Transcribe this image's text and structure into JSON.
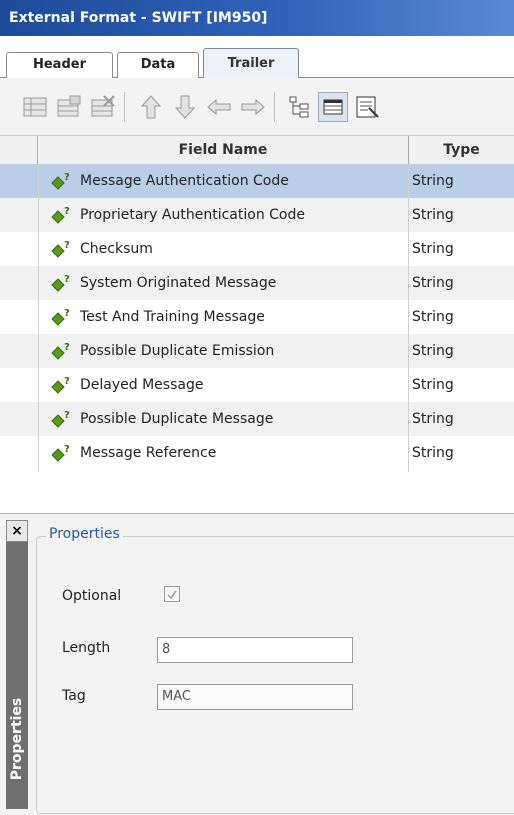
{
  "window": {
    "title": "External Format - SWIFT [IM950]"
  },
  "tabs": [
    {
      "label": "Header",
      "active": false
    },
    {
      "label": "Data",
      "active": false
    },
    {
      "label": "Trailer",
      "active": true
    }
  ],
  "toolbar": {
    "icons": [
      "insert-row-icon",
      "insert-child-icon",
      "delete-row-icon",
      "move-up-icon",
      "move-down-icon",
      "move-left-icon",
      "move-right-icon",
      "tree-view-icon",
      "grid-view-icon",
      "properties-icon"
    ],
    "selected": "grid-view-icon"
  },
  "grid": {
    "columns": {
      "name": "Field Name",
      "type": "Type"
    },
    "rows": [
      {
        "name": "Message Authentication Code",
        "type": "String",
        "selected": true
      },
      {
        "name": "Proprietary Authentication Code",
        "type": "String"
      },
      {
        "name": "Checksum",
        "type": "String"
      },
      {
        "name": "System Originated Message",
        "type": "String"
      },
      {
        "name": "Test And Training Message",
        "type": "String"
      },
      {
        "name": "Possible Duplicate Emission",
        "type": "String"
      },
      {
        "name": "Delayed Message",
        "type": "String"
      },
      {
        "name": "Possible Duplicate Message",
        "type": "String"
      },
      {
        "name": "Message Reference",
        "type": "String"
      }
    ],
    "colors": {
      "selected_row": "#b9cfe8",
      "alt_row": "#f1f1f1",
      "icon_green": "#5a9a1a"
    }
  },
  "properties": {
    "side_title": "Properties",
    "close_glyph": "×",
    "group_title": "Properties",
    "optional_label": "Optional",
    "optional_checked": true,
    "length_label": "Length",
    "length_value": "8",
    "tag_label": "Tag",
    "tag_value": "MAC"
  }
}
